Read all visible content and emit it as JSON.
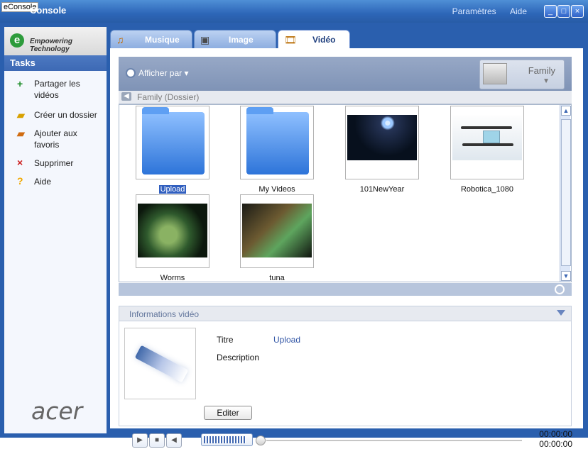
{
  "app": {
    "title": "eConsole",
    "title_bar_text": "Console",
    "top_links": [
      "Paramètres",
      "Aide"
    ],
    "window_buttons": [
      "minimize-icon",
      "maximize-icon",
      "close-icon"
    ]
  },
  "sidebar": {
    "brand_text": "Empowering Technology",
    "tasks_title": "Tasks",
    "tasks": [
      {
        "label": "Partager les vidéos",
        "icon": "plus-icon",
        "color": "#1d8d28"
      },
      {
        "label": "Créer un dossier",
        "icon": "folder-icon",
        "color": "#d8a100"
      },
      {
        "label": "Ajouter aux favoris",
        "icon": "favorite-folder-icon",
        "color": "#d06c11"
      },
      {
        "label": "Supprimer",
        "icon": "delete-icon",
        "color": "#cc1d1d"
      },
      {
        "label": "Aide",
        "icon": "help-icon",
        "color": "#f0a800"
      }
    ],
    "footer_logo": "acer"
  },
  "tabs": [
    {
      "label": "Musique",
      "icon": "music-icon",
      "active": false
    },
    {
      "label": "Image",
      "icon": "image-icon",
      "active": false
    },
    {
      "label": "Vidéo",
      "icon": "video-icon",
      "active": true
    }
  ],
  "browser": {
    "view_by": "Afficher par",
    "current_album": "Family",
    "breadcrumb": "Family (Dossier)",
    "items": [
      {
        "name": "Upload",
        "type": "folder",
        "selected": true
      },
      {
        "name": "My Videos",
        "type": "folder",
        "selected": false
      },
      {
        "name": "101NewYear",
        "type": "video",
        "selected": false
      },
      {
        "name": "Robotica_1080",
        "type": "video",
        "selected": false
      },
      {
        "name": "Worms",
        "type": "video",
        "selected": false
      },
      {
        "name": "tuna",
        "type": "video",
        "selected": false
      }
    ]
  },
  "info": {
    "title": "Informations vidéo",
    "fields": {
      "title_label": "Titre",
      "title_value": "Upload",
      "description_label": "Description"
    },
    "edit_label": "Editer"
  },
  "player": {
    "time_1": "00:00:00",
    "time_2": "00:00:00",
    "volume_fraction": 0.9
  }
}
